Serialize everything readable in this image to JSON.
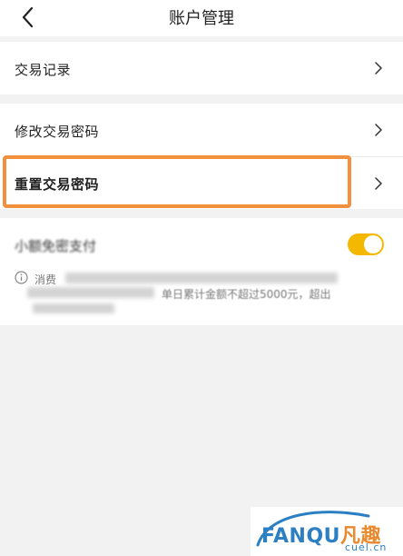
{
  "header": {
    "title": "账户管理",
    "back_icon": "chevron-left-icon"
  },
  "menu": {
    "records_label": "交易记录",
    "modify_password_label": "修改交易密码",
    "reset_password_label": "重置交易密码"
  },
  "small_amount": {
    "title": "小额免密支付",
    "toggle_on": true,
    "desc_line1": "消费",
    "desc_line2": "单日累计金额不超过5000元，超出"
  },
  "highlight_color": "#f2913d",
  "toggle_color": "#f5b800",
  "watermark": {
    "main": "FANQU",
    "cn": "凡趣",
    "sub": "cuel.cn"
  }
}
